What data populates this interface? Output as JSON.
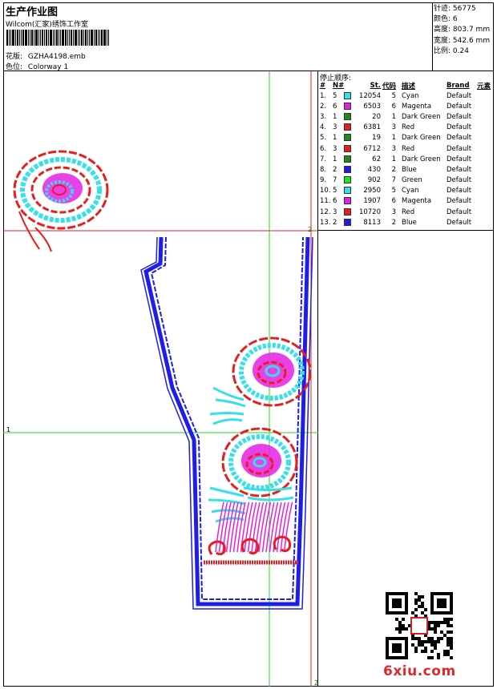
{
  "header": {
    "title": "生产作业图",
    "company": "Wilcom(汇家)绣饰工作室",
    "design_label": "花版:",
    "design_file": "GZHA4198.emb",
    "colorway_label": "色位:",
    "colorway": "Colorway 1"
  },
  "stats": {
    "stitches_label": "针迹:",
    "stitches": "56775",
    "colors_label": "颜色:",
    "colors": "6",
    "height_label": "高度:",
    "height": "803.7 mm",
    "width_label": "宽度:",
    "width": "542.6 mm",
    "scale_label": "比例:",
    "scale": "0.24"
  },
  "sequence": {
    "title": "停止顺序:",
    "headers": {
      "index": "#",
      "needle": "N#",
      "stitches": "St.",
      "code": "代码",
      "desc": "描述",
      "brand": "Brand",
      "element": "元素"
    },
    "rows": [
      {
        "index": "1.",
        "needle": "5",
        "color": "#35e0e6",
        "stitches": "12054",
        "code": "5",
        "desc": "Cyan",
        "brand": "Default"
      },
      {
        "index": "2.",
        "needle": "6",
        "color": "#e61ee6",
        "stitches": "6503",
        "code": "6",
        "desc": "Magenta",
        "brand": "Default"
      },
      {
        "index": "3.",
        "needle": "1",
        "color": "#1e8a1e",
        "stitches": "20",
        "code": "1",
        "desc": "Dark Green",
        "brand": "Default"
      },
      {
        "index": "4.",
        "needle": "3",
        "color": "#e61e1e",
        "stitches": "6381",
        "code": "3",
        "desc": "Red",
        "brand": "Default"
      },
      {
        "index": "5.",
        "needle": "1",
        "color": "#1e8a1e",
        "stitches": "19",
        "code": "1",
        "desc": "Dark Green",
        "brand": "Default"
      },
      {
        "index": "6.",
        "needle": "3",
        "color": "#e61e1e",
        "stitches": "6712",
        "code": "3",
        "desc": "Red",
        "brand": "Default"
      },
      {
        "index": "7.",
        "needle": "1",
        "color": "#1e8a1e",
        "stitches": "62",
        "code": "1",
        "desc": "Dark Green",
        "brand": "Default"
      },
      {
        "index": "8.",
        "needle": "2",
        "color": "#1e1ee6",
        "stitches": "430",
        "code": "2",
        "desc": "Blue",
        "brand": "Default"
      },
      {
        "index": "9.",
        "needle": "7",
        "color": "#1ee61e",
        "stitches": "902",
        "code": "7",
        "desc": "Green",
        "brand": "Default"
      },
      {
        "index": "10.",
        "needle": "5",
        "color": "#35e0e6",
        "stitches": "2950",
        "code": "5",
        "desc": "Cyan",
        "brand": "Default"
      },
      {
        "index": "11.",
        "needle": "6",
        "color": "#e61ee6",
        "stitches": "1907",
        "code": "6",
        "desc": "Magenta",
        "brand": "Default"
      },
      {
        "index": "12.",
        "needle": "3",
        "color": "#e61e1e",
        "stitches": "10720",
        "code": "3",
        "desc": "Red",
        "brand": "Default"
      },
      {
        "index": "13.",
        "needle": "2",
        "color": "#1e1ee6",
        "stitches": "8113",
        "code": "2",
        "desc": "Blue",
        "brand": "Default"
      }
    ]
  },
  "guides": {
    "left_marker": "1",
    "corner_marker": "2",
    "bottom_marker": "2"
  },
  "colors": {
    "red": "#e61e1e",
    "blue": "#1e1ee6",
    "cyan": "#35e0e6",
    "magenta": "#e61ee6",
    "green": "#22dd22"
  },
  "watermark": "6xiu.com"
}
